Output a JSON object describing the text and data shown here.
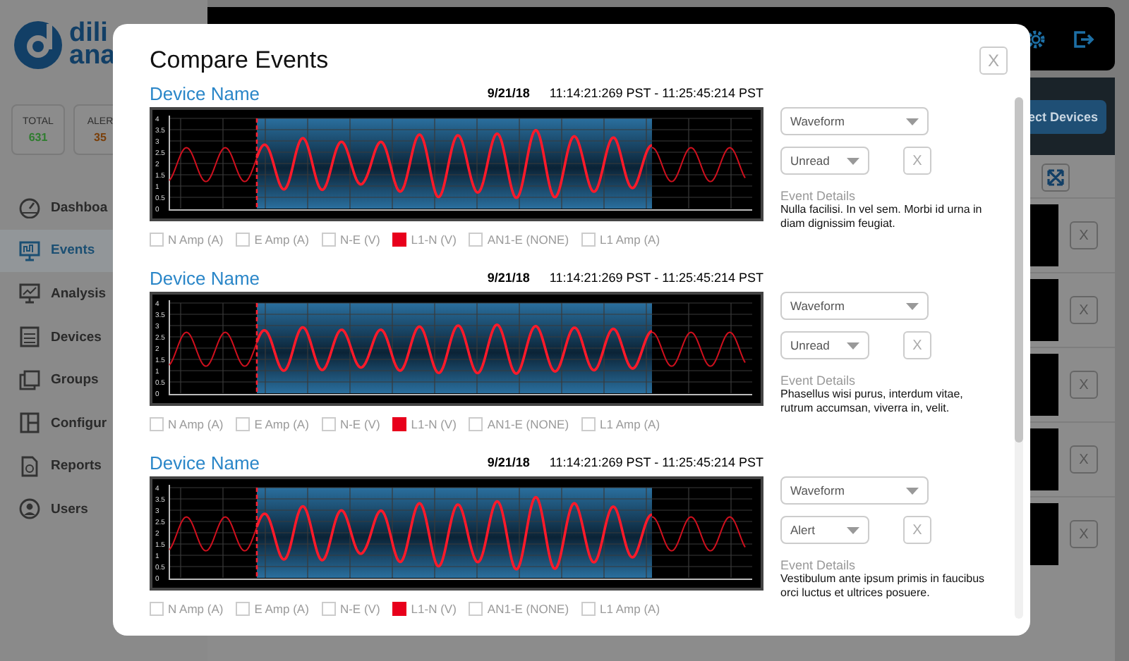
{
  "sidebar": {
    "logo": {
      "line_1": "dili",
      "line_2": "ana"
    },
    "stats": [
      {
        "label": "TOTAL",
        "value": "631",
        "color": "#2f7d2f"
      },
      {
        "label": "ALER",
        "value": "35",
        "color": "#7a3f0a"
      }
    ],
    "nav": [
      {
        "label": "Dashboa",
        "selected": false
      },
      {
        "label": "Events",
        "selected": true
      },
      {
        "label": "Analysis",
        "selected": false
      },
      {
        "label": "Devices",
        "selected": false
      },
      {
        "label": "Groups",
        "selected": false
      },
      {
        "label": "Configur",
        "selected": false
      },
      {
        "label": "Reports",
        "selected": false
      },
      {
        "label": "Users",
        "selected": false
      }
    ]
  },
  "device_panel": {
    "button": "ect Devices",
    "rows": [
      {
        "remove": "X"
      },
      {
        "remove": "X"
      },
      {
        "remove": "X"
      },
      {
        "remove": "X"
      },
      {
        "remove": "X"
      }
    ]
  },
  "modal": {
    "title": "Compare Events",
    "close": "X",
    "events": [
      {
        "device_name": "Device Name",
        "date": "9/21/18",
        "time_range": "11:14:21:269 PST - 11:25:45:214 PST",
        "y_axis_labels": [
          "4",
          "3.5",
          "3",
          "2.5",
          "2",
          "1.5",
          "1",
          "0.5",
          "0"
        ],
        "channels": [
          {
            "label": "N Amp (A)",
            "checked": false
          },
          {
            "label": "E Amp (A)",
            "checked": false
          },
          {
            "label": "N-E (V)",
            "checked": false
          },
          {
            "label": "L1-N (V)",
            "checked": true
          },
          {
            "label": "AN1-E (NONE)",
            "checked": false
          },
          {
            "label": "L1 Amp (A)",
            "checked": false
          }
        ],
        "type_select": "Waveform",
        "status_select": "Unread",
        "remove": "X",
        "details_label": "Event Details",
        "description": "Nulla facilisi. In vel sem. Morbi id urna in diam dignissim feugiat."
      },
      {
        "device_name": "Device Name",
        "date": "9/21/18",
        "time_range": "11:14:21:269 PST - 11:25:45:214 PST",
        "y_axis_labels": [
          "4",
          "3.5",
          "3",
          "2.5",
          "2",
          "1.5",
          "1",
          "0.5",
          "0"
        ],
        "channels": [
          {
            "label": "N Amp (A)",
            "checked": false
          },
          {
            "label": "E Amp (A)",
            "checked": false
          },
          {
            "label": "N-E (V)",
            "checked": false
          },
          {
            "label": "L1-N (V)",
            "checked": true
          },
          {
            "label": "AN1-E (NONE)",
            "checked": false
          },
          {
            "label": "L1 Amp (A)",
            "checked": false
          }
        ],
        "type_select": "Waveform",
        "status_select": "Unread",
        "remove": "X",
        "details_label": "Event Details",
        "description": "Phasellus wisi purus, interdum vitae, rutrum accumsan, viverra in, velit."
      },
      {
        "device_name": "Device Name",
        "date": "9/21/18",
        "time_range": "11:14:21:269 PST - 11:25:45:214 PST",
        "y_axis_labels": [
          "4",
          "3.5",
          "3",
          "2.5",
          "2",
          "1.5",
          "1",
          "0.5",
          "0"
        ],
        "channels": [
          {
            "label": "N Amp (A)",
            "checked": false
          },
          {
            "label": "E Amp (A)",
            "checked": false
          },
          {
            "label": "N-E (V)",
            "checked": false
          },
          {
            "label": "L1-N (V)",
            "checked": true
          },
          {
            "label": "AN1-E (NONE)",
            "checked": false
          },
          {
            "label": "L1 Amp (A)",
            "checked": false
          }
        ],
        "type_select": "Waveform",
        "status_select": "Alert",
        "remove": "X",
        "details_label": "Event Details",
        "description": "Vestibulum ante ipsum primis in faucibus orci luctus et ultrices posuere."
      }
    ]
  }
}
